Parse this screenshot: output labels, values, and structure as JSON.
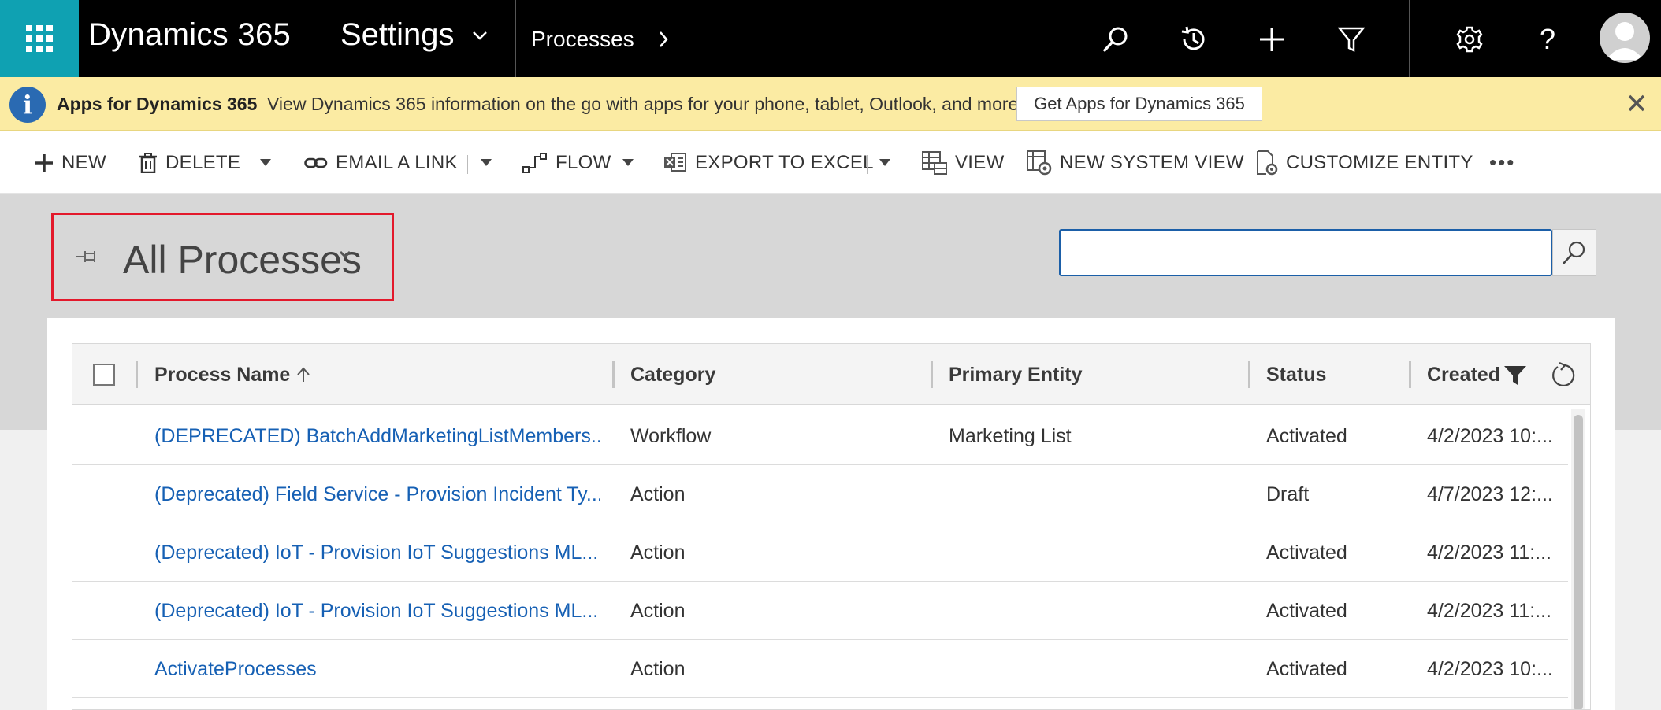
{
  "topbar": {
    "brand": "Dynamics 365",
    "area": "Settings",
    "breadcrumb": "Processes",
    "icons": [
      "waffle-icon",
      "search-icon",
      "recent-icon",
      "plus-icon",
      "filter-icon",
      "gear-icon",
      "help-icon",
      "user-avatar"
    ]
  },
  "notification": {
    "title": "Apps for Dynamics 365",
    "message": "View Dynamics 365 information on the go with apps for your phone, tablet, Outlook, and more!",
    "button": "Get Apps for Dynamics 365"
  },
  "commands": {
    "new": "NEW",
    "delete": "DELETE",
    "email_link": "EMAIL A LINK",
    "flow": "FLOW",
    "export_excel": "EXPORT TO EXCEL",
    "view": "VIEW",
    "new_system_view": "NEW SYSTEM VIEW",
    "customize_entity": "CUSTOMIZE ENTITY",
    "more": "•••"
  },
  "view": {
    "title": "All Processes",
    "search_value": ""
  },
  "grid": {
    "columns": {
      "process_name": "Process Name",
      "category": "Category",
      "primary_entity": "Primary Entity",
      "status": "Status",
      "created": "Created"
    },
    "rows": [
      {
        "name": "(DEPRECATED) BatchAddMarketingListMembers...",
        "category": "Workflow",
        "entity": "Marketing List",
        "status": "Activated",
        "created": "4/2/2023 10:..."
      },
      {
        "name": "(Deprecated) Field Service - Provision Incident Ty...",
        "category": "Action",
        "entity": "",
        "status": "Draft",
        "created": "4/7/2023 12:..."
      },
      {
        "name": "(Deprecated) IoT - Provision IoT Suggestions ML...",
        "category": "Action",
        "entity": "",
        "status": "Activated",
        "created": "4/2/2023 11:..."
      },
      {
        "name": "(Deprecated) IoT - Provision IoT Suggestions ML...",
        "category": "Action",
        "entity": "",
        "status": "Activated",
        "created": "4/2/2023 11:..."
      },
      {
        "name": "ActivateProcesses",
        "category": "Action",
        "entity": "",
        "status": "Activated",
        "created": "4/2/2023 10:..."
      }
    ]
  },
  "colors": {
    "waffle_bg": "#0fa1b2",
    "topbar_bg": "#000000",
    "notify_bg": "#fbeba3",
    "link": "#1660b4",
    "highlight_border": "#e3192b",
    "search_border": "#1b5fa8"
  }
}
